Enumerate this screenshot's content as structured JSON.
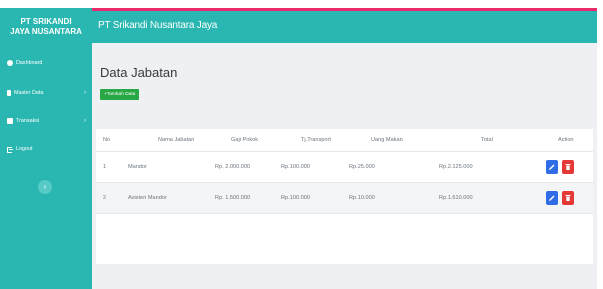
{
  "brand": {
    "line1": "PT SRIKANDI",
    "line2": "JAYA NUSANTARA"
  },
  "header": {
    "title": "PT Srikandi Nusantara Jaya"
  },
  "sidebar": {
    "items": [
      {
        "label": "Dashboard",
        "icon": "dashboard-icon"
      },
      {
        "label": "Master Data",
        "icon": "database-icon",
        "chevron": "›"
      },
      {
        "label": "Transaksi",
        "icon": "transaction-icon",
        "chevron": "›"
      },
      {
        "label": "Logout",
        "icon": "logout-icon"
      }
    ],
    "toggle": "‹"
  },
  "main": {
    "title": "Data Jabatan",
    "add_button": "+Tambah Data",
    "table": {
      "headers": [
        "No",
        "Nama Jabatan",
        "Gaji Pokok",
        "Tj.Transport",
        "Uang Makan",
        "Total",
        "Action"
      ],
      "rows": [
        {
          "no": "1",
          "nama": "Mandor",
          "gaji": "Rp. 2.000.000",
          "tj": "Rp.100.000",
          "um": "Rp.25.000",
          "total": "Rp.2.125.000"
        },
        {
          "no": "2",
          "nama": "Asisten Mandor",
          "gaji": "Rp. 1.500.000",
          "tj": "Rp.100.000",
          "um": "Rp.10.000",
          "total": "Rp.1.610.000"
        }
      ]
    }
  },
  "colors": {
    "sidebar": "#2bb7b1",
    "accent_line": "#ea2a6b",
    "add_button": "#28a745",
    "edit_button": "#2f6ce6",
    "delete_button": "#e53935"
  }
}
